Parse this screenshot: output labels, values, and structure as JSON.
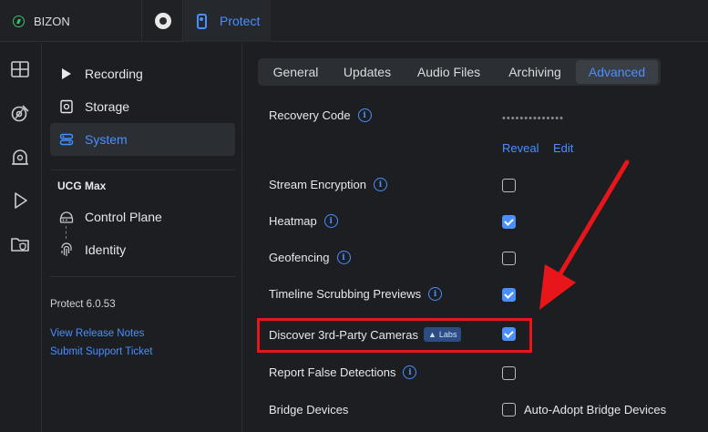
{
  "topbar": {
    "site_name": "BIZON",
    "app_name": "Protect"
  },
  "rail": {
    "icons": [
      "dashboard-icon",
      "devices-icon",
      "alarm-icon",
      "play-icon",
      "folder-shield-icon"
    ]
  },
  "sidebar": {
    "items": [
      {
        "label": "Recording",
        "icon": "recording-icon"
      },
      {
        "label": "Storage",
        "icon": "storage-icon"
      },
      {
        "label": "System",
        "icon": "system-icon",
        "active": true
      }
    ],
    "device": {
      "title": "UCG Max",
      "items": [
        {
          "label": "Control Plane",
          "icon": "control-plane-icon"
        },
        {
          "label": "Identity",
          "icon": "fingerprint-icon"
        }
      ]
    },
    "version": "Protect 6.0.53",
    "links": [
      "View Release Notes",
      "Submit Support Ticket"
    ]
  },
  "tabs": [
    "General",
    "Updates",
    "Audio Files",
    "Archiving",
    "Advanced"
  ],
  "active_tab": "Advanced",
  "settings": {
    "recovery_code": {
      "label": "Recovery Code",
      "value": "••••••••••••••",
      "reveal": "Reveal",
      "edit": "Edit"
    },
    "rows": [
      {
        "label": "Stream Encryption",
        "checked": false
      },
      {
        "label": "Heatmap",
        "checked": true
      },
      {
        "label": "Geofencing",
        "checked": false
      },
      {
        "label": "Timeline Scrubbing Previews",
        "checked": true
      },
      {
        "label": "Discover 3rd-Party Cameras",
        "badge": "Labs",
        "checked": true
      },
      {
        "label": "Report False Detections",
        "checked": false
      },
      {
        "label": "Bridge Devices",
        "option": "Auto-Adopt Bridge Devices",
        "checked": false
      }
    ]
  },
  "colors": {
    "accent": "#4a8fff",
    "highlight": "#e8161b",
    "background": "#1c1e21"
  }
}
